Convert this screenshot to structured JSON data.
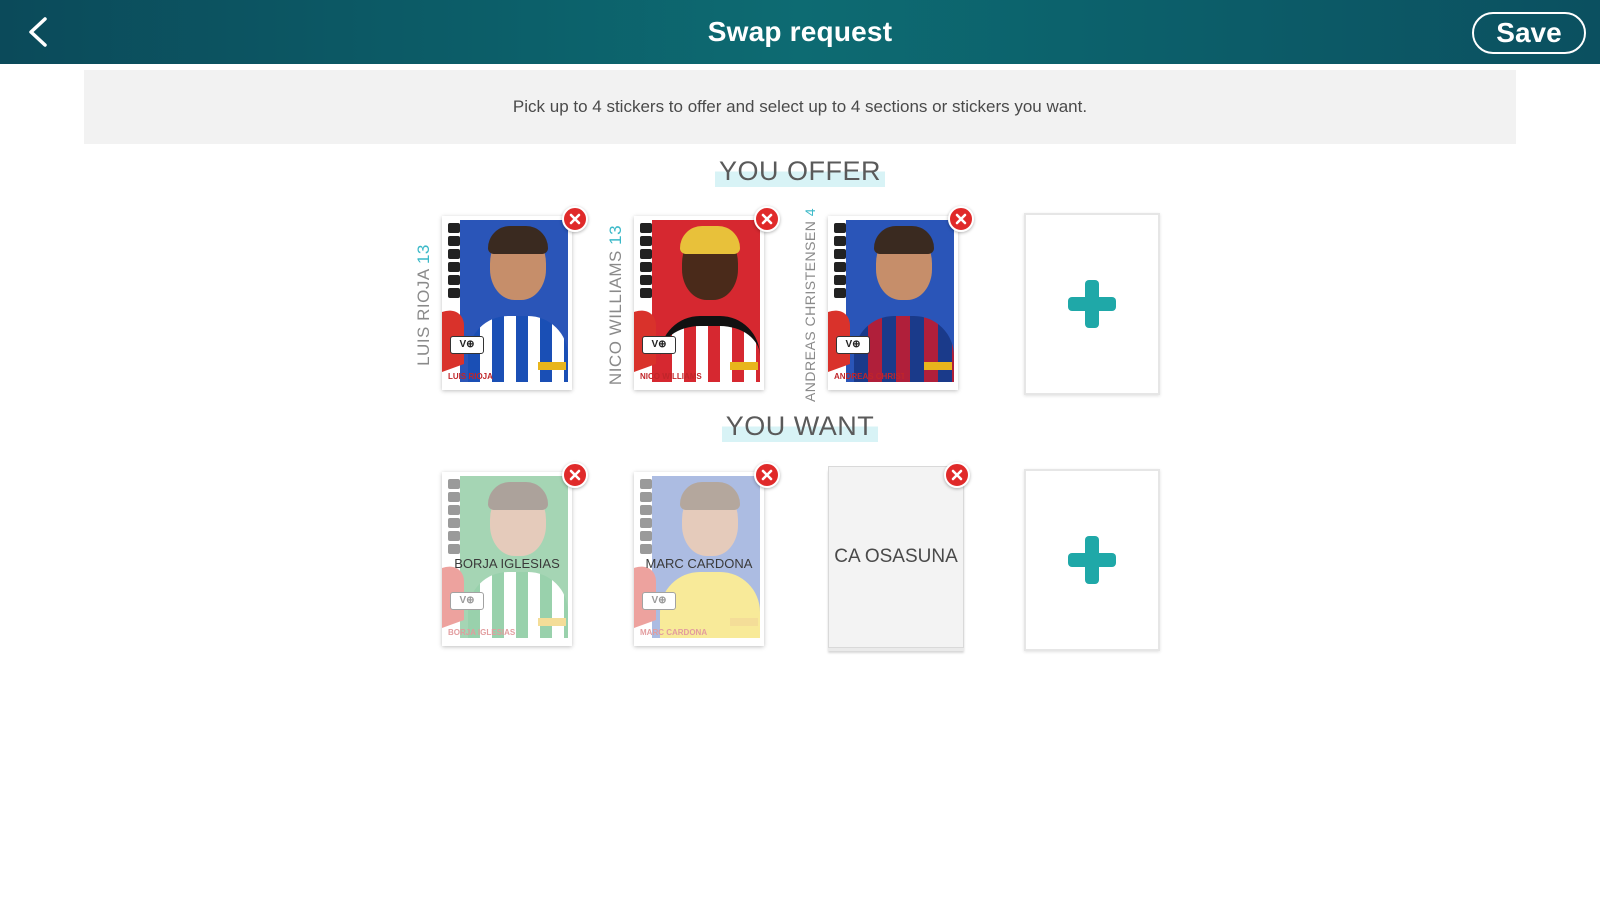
{
  "header": {
    "title": "Swap request",
    "save_label": "Save",
    "background": "#0d6b72"
  },
  "info": {
    "text": "Pick up to 4 stickers to offer and select up to 4 sections or stickers you want."
  },
  "offer": {
    "label": "YOU OFFER",
    "stickers": [
      {
        "name": "LUIS RIOJA",
        "number": "13",
        "plate": "LUIS RIOJA",
        "bg": "#2a55b8",
        "shirt": "stripes-blue",
        "hair": "#3a2a20"
      },
      {
        "name": "NICO WILLIAMS",
        "number": "13",
        "plate": "NICO WILLIAMS",
        "bg": "#d62830",
        "shirt": "stripes-red",
        "hair": "#e8c13a"
      },
      {
        "name": "ANDREAS CHRISTENSEN",
        "number": "4",
        "plate": "ANDREAS CHRISTENSEN",
        "bg": "#2a55b8",
        "shirt": "barca",
        "hair": "#3a2a20"
      }
    ],
    "add_icon": "plus-icon"
  },
  "want": {
    "label": "YOU WANT",
    "items": [
      {
        "type": "sticker",
        "name": "BORJA IGLESIAS",
        "plate": "BORJA IGLESIAS",
        "bg": "#3aa35a",
        "shirt": "stripes-green",
        "hair": "#4a3324"
      },
      {
        "type": "sticker",
        "name": "MARC CARDONA",
        "plate": "MARC CARDONA",
        "bg": "#4a6cc0",
        "shirt": "yellow",
        "hair": "#5a3e28"
      },
      {
        "type": "section",
        "name": "CA OSASUNA"
      }
    ],
    "add_icon": "plus-icon"
  },
  "colors": {
    "accent": "#1fa8a8",
    "remove": "#e02a2a"
  }
}
